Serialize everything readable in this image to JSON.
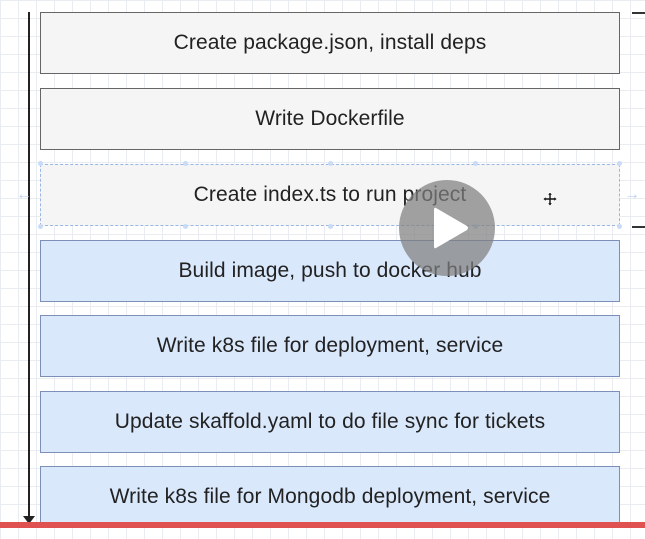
{
  "steps": [
    {
      "label": "Create package.json, install deps",
      "style": "gray"
    },
    {
      "label": "Write Dockerfile",
      "style": "gray"
    },
    {
      "label": "Create index.ts to run project",
      "style": "gray",
      "selected": true
    },
    {
      "label": "Build image, push to docker hub",
      "style": "blue"
    },
    {
      "label": "Write k8s file for deployment, service",
      "style": "blue"
    },
    {
      "label": "Update skaffold.yaml to do file sync for tickets",
      "style": "blue"
    },
    {
      "label": "Write k8s file for Mongodb deployment, service",
      "style": "blue"
    }
  ],
  "colors": {
    "gray_fill": "#f5f5f5",
    "blue_fill": "#dae8fc",
    "progress": "#e05252",
    "selection": "#9ab6e4"
  },
  "player": {
    "play_icon": "play-icon",
    "progress_fraction": 1.0
  },
  "icons": {
    "cursor": "move-cursor-icon",
    "side_arrows": "arrow-left-right-icon"
  }
}
